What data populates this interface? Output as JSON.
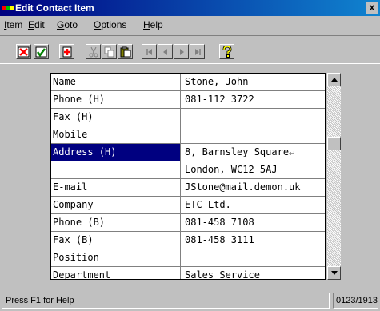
{
  "window": {
    "title": "Edit Contact Item",
    "close_label": "x"
  },
  "menu": [
    {
      "label": "Item",
      "mnemonic": "I",
      "rest": "tem"
    },
    {
      "label": "Edit",
      "mnemonic": "E",
      "rest": "dit"
    },
    {
      "label": "Goto",
      "mnemonic": "G",
      "rest": "oto"
    },
    {
      "label": "Options",
      "mnemonic": "O",
      "rest": "ptions"
    },
    {
      "label": "Help",
      "mnemonic": "H",
      "rest": "elp"
    }
  ],
  "toolbar": {
    "buttons": [
      {
        "icon": "cancel-icon"
      },
      {
        "icon": "ok-icon"
      },
      {
        "icon": "new-icon"
      },
      {
        "icon": "cut-icon"
      },
      {
        "icon": "copy-icon"
      },
      {
        "icon": "paste-icon"
      },
      {
        "icon": "first-record-icon"
      },
      {
        "icon": "previous-record-icon"
      },
      {
        "icon": "next-record-icon"
      },
      {
        "icon": "last-record-icon"
      },
      {
        "icon": "help-icon"
      }
    ]
  },
  "contact": {
    "fields": [
      {
        "label": "Name",
        "value": "Stone, John"
      },
      {
        "label": "Phone (H)",
        "value": "081-112 3722"
      },
      {
        "label": "Fax (H)",
        "value": ""
      },
      {
        "label": "Mobile",
        "value": ""
      },
      {
        "label": "Address (H)",
        "value": "8, Barnsley Square↵"
      },
      {
        "label": "",
        "value": "London, WC12 5AJ"
      },
      {
        "label": "E-mail",
        "value": "JStone@mail.demon.uk"
      },
      {
        "label": "Company",
        "value": "ETC Ltd."
      },
      {
        "label": "Phone (B)",
        "value": "081-458 7108"
      },
      {
        "label": "Fax (B)",
        "value": "081-458 3111"
      },
      {
        "label": "Position",
        "value": ""
      },
      {
        "label": "Department",
        "value": "Sales Service"
      }
    ],
    "selected_index": 4
  },
  "status": {
    "help_text": "Press F1 for Help",
    "record_counter": "0123/1913"
  }
}
